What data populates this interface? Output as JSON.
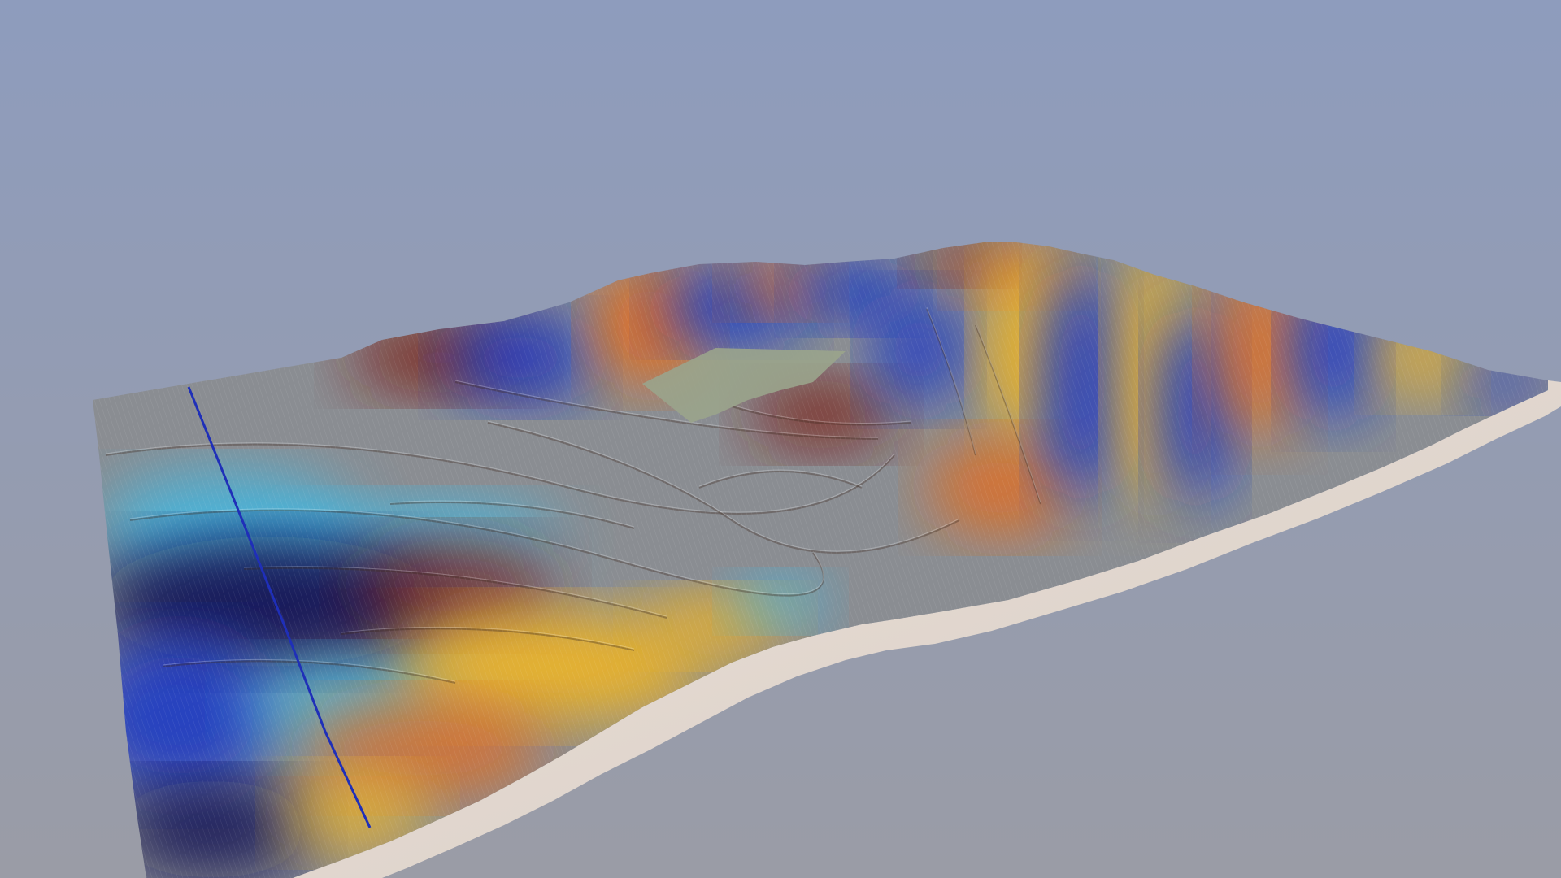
{
  "scene": {
    "kind": "3d-terrain-model",
    "render": {
      "background_top": "#8e9cbd",
      "background_bottom": "#9a9ca6",
      "base_color": "#ece2da",
      "base_shadow": "#d6cbc2",
      "hillshade_grey": "#8a8d92"
    },
    "colormap": [
      "#0a0f52",
      "#1535c8",
      "#36c0f0",
      "#8a8d92",
      "#f7b81c",
      "#ea6a12",
      "#7a1e12"
    ],
    "overlay": {
      "kind": "aerial-image-patch",
      "color": "#9aa48c"
    },
    "line": {
      "color": "#1f2fb8"
    }
  }
}
